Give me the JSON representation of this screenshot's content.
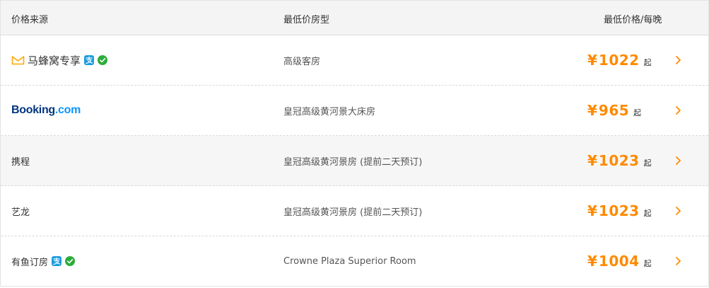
{
  "header": {
    "source_label": "价格来源",
    "room_label": "最低价房型",
    "price_label": "最低价格/每晚"
  },
  "rows": [
    {
      "source": "马蜂窝专享",
      "source_icon": "mafengwo-icon",
      "pay_icons": [
        "alipay-icon",
        "wechat-pay-icon"
      ],
      "room": "高级客房",
      "currency": "¥",
      "price": "1022",
      "suffix": "起"
    },
    {
      "source_logo_main": "Booking",
      "source_logo_com": ".com",
      "room": "皇冠高级黄河景大床房",
      "currency": "¥",
      "price": "965",
      "suffix": "起"
    },
    {
      "source": "携程",
      "room": "皇冠高级黄河景房 (提前二天预订)",
      "currency": "¥",
      "price": "1023",
      "suffix": "起"
    },
    {
      "source": "艺龙",
      "room": "皇冠高级黄河景房 (提前二天预订)",
      "currency": "¥",
      "price": "1023",
      "suffix": "起"
    },
    {
      "source": "有鱼订房",
      "pay_icons": [
        "alipay-icon",
        "wechat-pay-icon"
      ],
      "room": "Crowne Plaza Superior Room",
      "currency": "¥",
      "price": "1004",
      "suffix": "起"
    }
  ],
  "colors": {
    "price": "#ff8a00",
    "booking_blue": "#003580",
    "booking_light": "#0896ff",
    "alipay": "#1e9bdf",
    "wechat": "#2bad3b",
    "mafengwo": "#ffa800"
  }
}
